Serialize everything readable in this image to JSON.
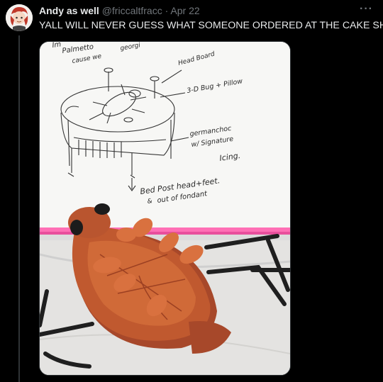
{
  "tweet": {
    "display_name": "Andy as well",
    "handle": "@friccaltfracc",
    "separator": "·",
    "date": "Apr 22",
    "more_icon": "ellipsis-icon",
    "text": "YALL WILL NEVER GUESS WHAT SOMEONE ORDERED AT THE CAKE SHOP"
  },
  "media": {
    "sketch": {
      "top_left_1": "Im",
      "top_left_2": "Palmetto",
      "top_left_3": "cause  we",
      "top_left_4": "georgi",
      "headboard": "Head Board",
      "bug_pillow": "3-D Bug + Pillow",
      "cake_1": "germanchoc",
      "cake_2": "w/ Signature",
      "cake_3": "Icing.",
      "post_1": "Bed Post  head+feet.",
      "post_2": "out of fondant",
      "post_symbol": "&"
    }
  },
  "colors": {
    "background": "#000000",
    "text_primary": "#e7e9ea",
    "text_secondary": "#71767b",
    "border": "#2f3336",
    "fondant": "#b8532e",
    "fondant_light": "#d9713f",
    "pink_edge": "#ff6fb5"
  }
}
